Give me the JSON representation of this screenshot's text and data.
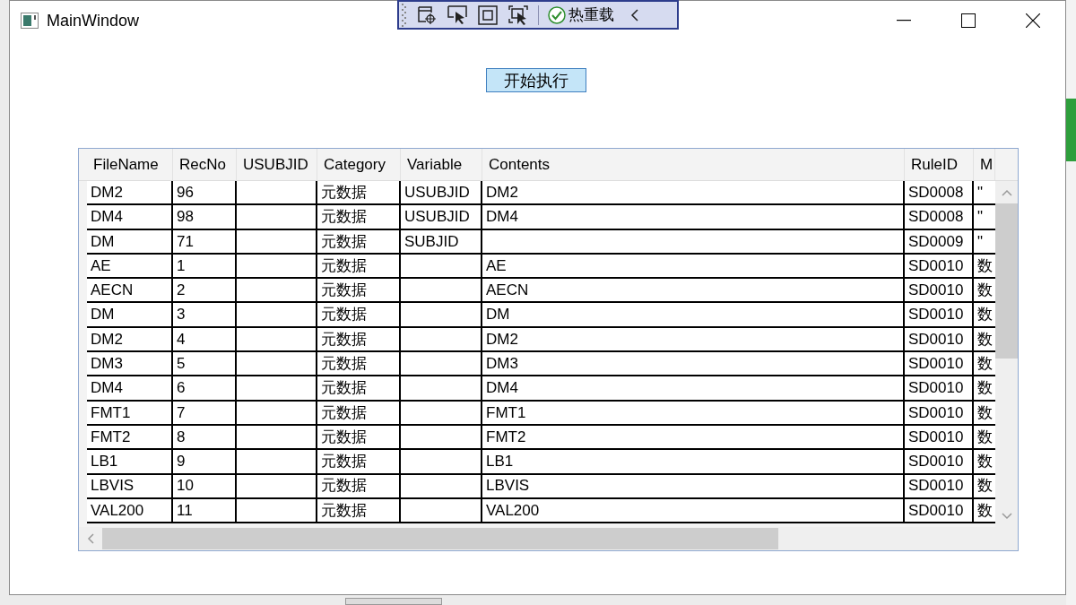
{
  "window": {
    "title": "MainWindow"
  },
  "toolbar": {
    "hot_reload": "热重载"
  },
  "start_button": "开始执行",
  "table": {
    "columns": [
      "FileName",
      "RecNo",
      "USUBJID",
      "Category",
      "Variable",
      "Contents",
      "RuleID",
      "M"
    ],
    "rows": [
      [
        "DM2",
        "96",
        null,
        "元数据",
        "USUBJID",
        "DM2",
        "SD0008",
        "\""
      ],
      [
        "DM4",
        "98",
        null,
        "元数据",
        "USUBJID",
        "DM4",
        "SD0008",
        "\""
      ],
      [
        "DM",
        "71",
        null,
        "元数据",
        "SUBJID",
        null,
        "SD0009",
        "\""
      ],
      [
        "AE",
        "1",
        null,
        "元数据",
        null,
        "AE",
        "SD0010",
        "数"
      ],
      [
        "AECN",
        "2",
        null,
        "元数据",
        null,
        "AECN",
        "SD0010",
        "数"
      ],
      [
        "DM",
        "3",
        null,
        "元数据",
        null,
        "DM",
        "SD0010",
        "数"
      ],
      [
        "DM2",
        "4",
        null,
        "元数据",
        null,
        "DM2",
        "SD0010",
        "数"
      ],
      [
        "DM3",
        "5",
        null,
        "元数据",
        null,
        "DM3",
        "SD0010",
        "数"
      ],
      [
        "DM4",
        "6",
        null,
        "元数据",
        null,
        "DM4",
        "SD0010",
        "数"
      ],
      [
        "FMT1",
        "7",
        null,
        "元数据",
        null,
        "FMT1",
        "SD0010",
        "数"
      ],
      [
        "FMT2",
        "8",
        null,
        "元数据",
        null,
        "FMT2",
        "SD0010",
        "数"
      ],
      [
        "LB1",
        "9",
        null,
        "元数据",
        null,
        "LB1",
        "SD0010",
        "数"
      ],
      [
        "LBVIS",
        "10",
        null,
        "元数据",
        null,
        "LBVIS",
        "SD0010",
        "数"
      ],
      [
        "VAL200",
        "11",
        null,
        "元数据",
        null,
        "VAL200",
        "SD0010",
        "数"
      ]
    ]
  }
}
